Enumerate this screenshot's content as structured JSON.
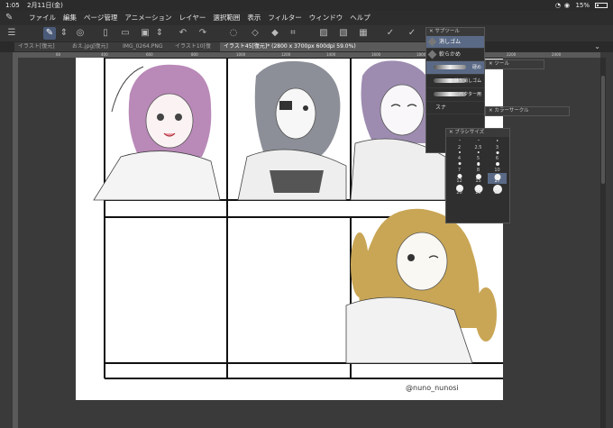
{
  "status": {
    "time": "1:05",
    "date": "2月11日(金)",
    "battery": "15%",
    "battery_level": 0.15
  },
  "menubar": {
    "items": [
      "ファイル",
      "編集",
      "ページ管理",
      "アニメーション",
      "レイヤー",
      "選択範囲",
      "表示",
      "フィルター",
      "ウィンドウ",
      "ヘルプ"
    ]
  },
  "tabs": [
    {
      "label": "イラスト[復元]",
      "active": false
    },
    {
      "label": "おえ.jpg[復元]",
      "active": false
    },
    {
      "label": "IMG_0264.PNG",
      "active": false
    },
    {
      "label": "イラスト10[復",
      "active": false
    },
    {
      "label": "イラスト45[復元]* (2800 x 3700px 600dpi 59.0%)",
      "active": true
    }
  ],
  "ruler": {
    "labels": [
      "60",
      "400",
      "600",
      "800",
      "1000",
      "1200",
      "1400",
      "1600",
      "1800",
      "2000",
      "2200",
      "2400"
    ]
  },
  "subtool_panel": {
    "title": "サブツール",
    "items": [
      {
        "label": "消しゴム",
        "active": true
      },
      {
        "label": "軟らかめ",
        "active": false
      }
    ],
    "brushes": [
      {
        "label": "硬め",
        "active": true
      },
      {
        "label": "練り消しゴム",
        "active": false
      },
      {
        "label": "ベクター用",
        "active": false
      }
    ],
    "truncated_label": "スナ"
  },
  "tool_panel": {
    "title": "ツール"
  },
  "color_panel": {
    "title": "カラーサークル"
  },
  "brushsize_panel": {
    "title": "ブラシサイズ",
    "sizes": [
      "2",
      "2.5",
      "3",
      "4",
      "5",
      "6",
      "7",
      "8",
      "10",
      "12",
      "15",
      "17",
      "20",
      "25",
      "30"
    ],
    "selected": "17"
  },
  "canvas": {
    "watermark": "@nuno_nunosi"
  },
  "icons": {
    "app_logo": "clip-studio-logo-icon",
    "wifi": "wifi-icon"
  }
}
